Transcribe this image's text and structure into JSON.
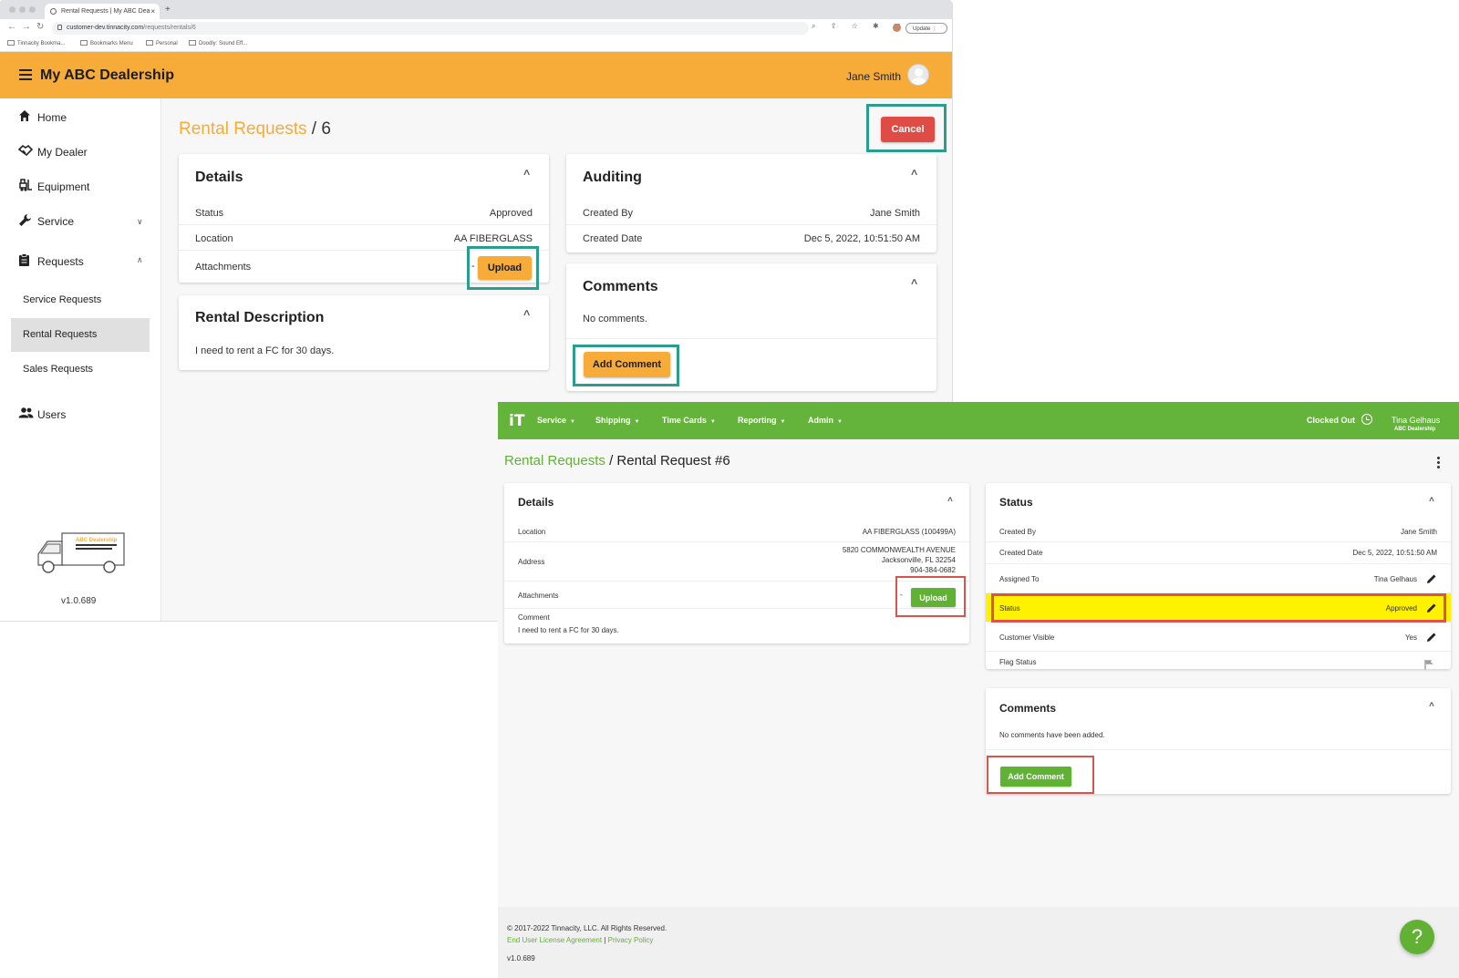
{
  "browser": {
    "tab_title": "Rental Requests | My ABC Dea",
    "new_tab": "+",
    "url_host": "customer-dev.tinnacity.com",
    "url_path": "/requests/rentals/6",
    "update_label": "Update",
    "bookmarks": [
      "Tinnacity Bookma...",
      "Bookmarks Menu",
      "Personal",
      "Doodly: Sound Eff..."
    ]
  },
  "customer_app": {
    "title": "My ABC Dealership",
    "user_name": "Jane Smith",
    "accent_color": "#f7ac3a",
    "sidebar": {
      "items": [
        {
          "label": "Home",
          "icon": "home-icon"
        },
        {
          "label": "My Dealer",
          "icon": "handshake-icon"
        },
        {
          "label": "Equipment",
          "icon": "forklift-icon"
        },
        {
          "label": "Service",
          "icon": "wrench-icon"
        },
        {
          "label": "Requests",
          "icon": "clipboard-icon"
        },
        {
          "label": "Users",
          "icon": "users-icon"
        }
      ],
      "subitems": [
        "Service Requests",
        "Rental Requests",
        "Sales Requests"
      ],
      "version": "v1.0.689",
      "logo_text": "ABC Dealership"
    },
    "breadcrumb": {
      "link": "Rental Requests",
      "separator": "/",
      "current": "6"
    },
    "cancel_label": "Cancel",
    "details": {
      "title": "Details",
      "status_label": "Status",
      "status_value": "Approved",
      "location_label": "Location",
      "location_value": "AA FIBERGLASS",
      "attachments_label": "Attachments",
      "attachments_value": "-",
      "upload_label": "Upload"
    },
    "rental_description": {
      "title": "Rental Description",
      "text": "I need to rent a FC for 30 days."
    },
    "auditing": {
      "title": "Auditing",
      "created_by_label": "Created By",
      "created_by_value": "Jane Smith",
      "created_date_label": "Created Date",
      "created_date_value": "Dec 5, 2022, 10:51:50 AM"
    },
    "comments": {
      "title": "Comments",
      "empty_text": "No comments.",
      "add_label": "Add Comment"
    }
  },
  "dealer_app": {
    "logo": "iT",
    "accent_color": "#64b33a",
    "nav": [
      "Service",
      "Shipping",
      "Time Cards",
      "Reporting",
      "Admin"
    ],
    "clock_status": "Clocked Out",
    "user_name": "Tina Gelhaus",
    "user_org": "ABC Dealership",
    "breadcrumb": {
      "link": "Rental Requests",
      "separator": "/",
      "current": "Rental Request #6"
    },
    "details": {
      "title": "Details",
      "location_label": "Location",
      "location_value": "AA FIBERGLASS (100499A)",
      "address_label": "Address",
      "address_line1": "5820 COMMONWEALTH AVENUE",
      "address_line2": "Jacksonville, FL 32254",
      "address_line3": "904-384-0682",
      "attachments_label": "Attachments",
      "attachments_value": "-",
      "upload_label": "Upload",
      "comment_label": "Comment",
      "comment_value": "I need to rent a FC for 30 days."
    },
    "status": {
      "title": "Status",
      "created_by_label": "Created By",
      "created_by_value": "Jane Smith",
      "created_date_label": "Created Date",
      "created_date_value": "Dec 5, 2022, 10:51:50 AM",
      "assigned_label": "Assigned To",
      "assigned_value": "Tina Gelhaus",
      "status_label": "Status",
      "status_value": "Approved",
      "visible_label": "Customer Visible",
      "visible_value": "Yes",
      "flag_label": "Flag Status"
    },
    "comments": {
      "title": "Comments",
      "empty_text": "No comments have been added.",
      "add_label": "Add Comment"
    },
    "footer": {
      "copyright": "© 2017-2022 Tinnacity, LLC. All Rights Reserved.",
      "eula": "End User License Agreement",
      "divider": "|",
      "privacy": "Privacy Policy",
      "version": "v1.0.689"
    },
    "help_label": "?"
  },
  "highlight_colors": {
    "teal": "#2a9d8f",
    "red": "#d9534f",
    "status_row": "#fff200"
  }
}
